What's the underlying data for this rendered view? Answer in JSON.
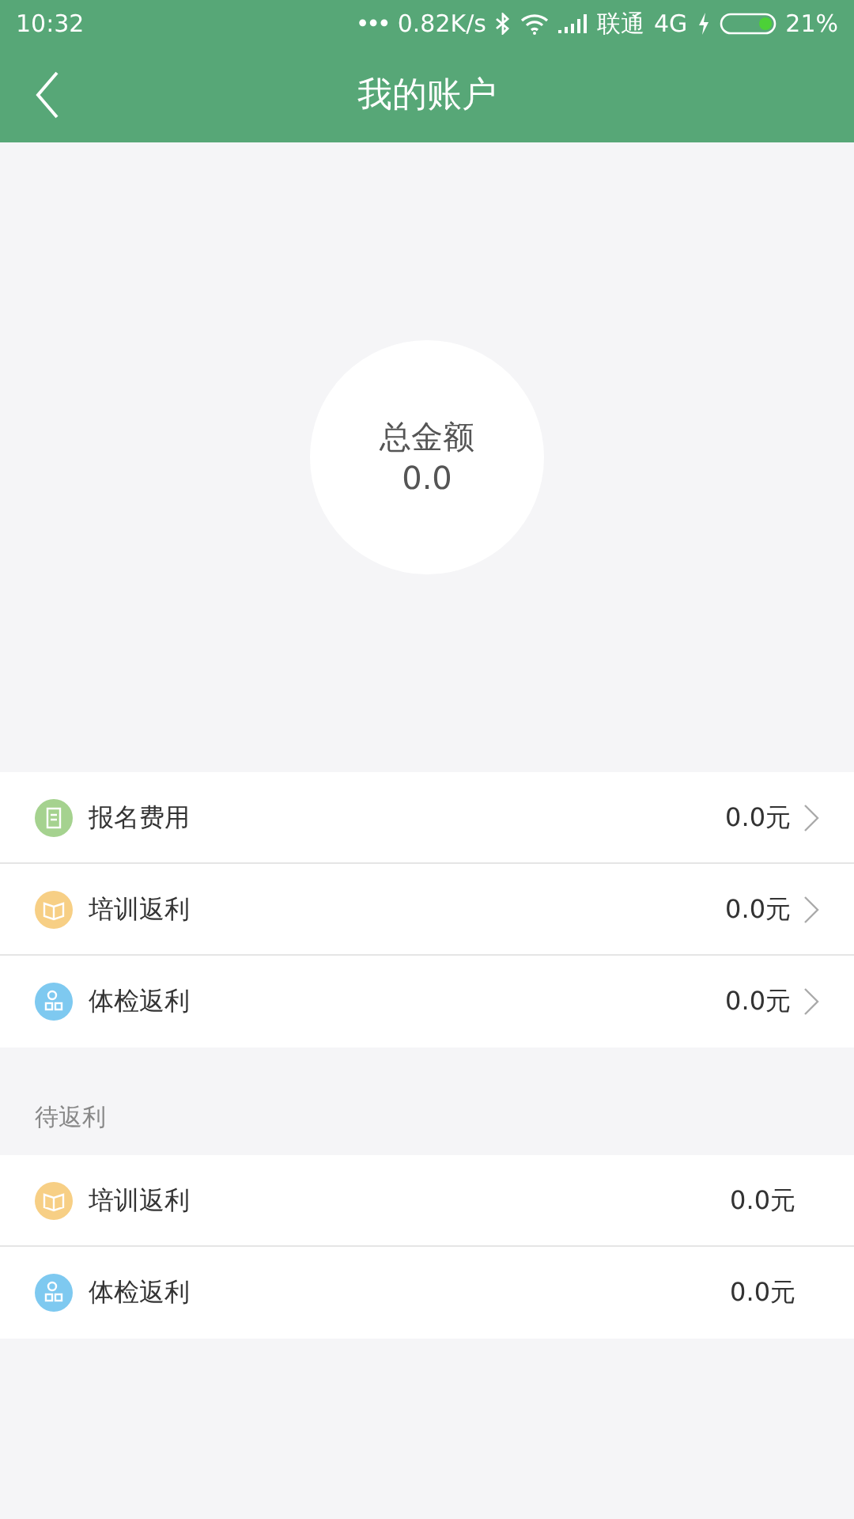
{
  "status_bar": {
    "time": "10:32",
    "dots": "•••",
    "speed": "0.82K/s",
    "carrier": "联通",
    "network": "4G",
    "battery_level": "21%"
  },
  "header": {
    "title": "我的账户"
  },
  "summary": {
    "label": "总金额",
    "amount": "0.0"
  },
  "accounts": [
    {
      "kind": "document",
      "color": "#a5d28f",
      "label": "报名费用",
      "amount": "0.0元",
      "chevron": true
    },
    {
      "kind": "book",
      "color": "#f7cf85",
      "label": "培训返利",
      "amount": "0.0元",
      "chevron": true
    },
    {
      "kind": "people",
      "color": "#7ec9f0",
      "label": "体检返利",
      "amount": "0.0元",
      "chevron": true
    }
  ],
  "pending": {
    "title": "待返利",
    "items": [
      {
        "kind": "book",
        "color": "#f7cf85",
        "label": "培训返利",
        "amount": "0.0元",
        "chevron": false
      },
      {
        "kind": "people",
        "color": "#7ec9f0",
        "label": "体检返利",
        "amount": "0.0元",
        "chevron": false
      }
    ]
  }
}
